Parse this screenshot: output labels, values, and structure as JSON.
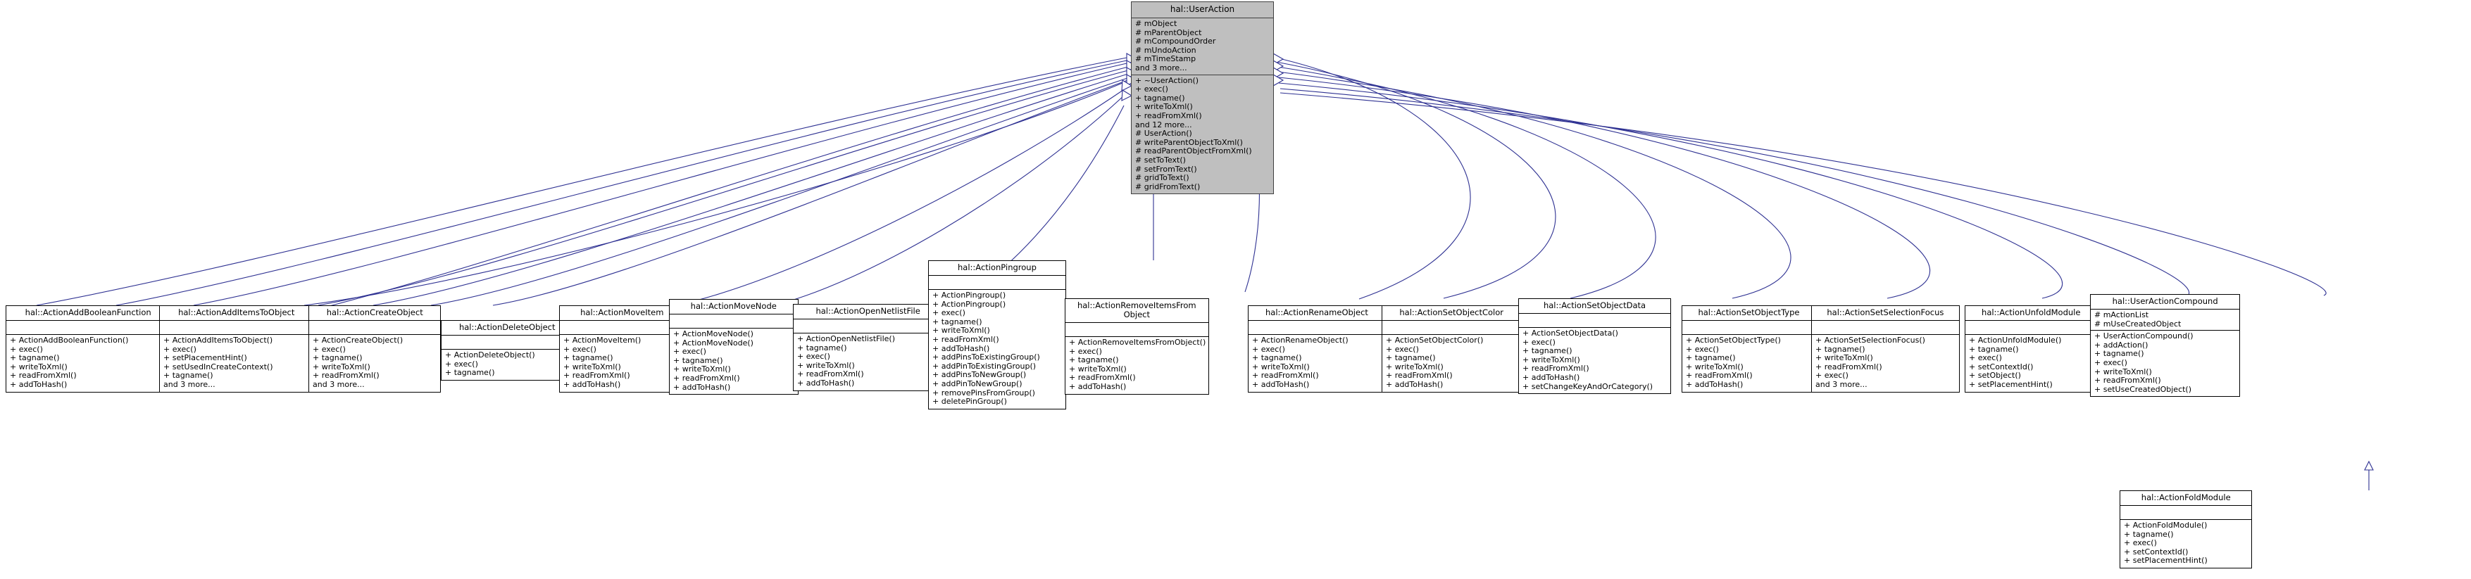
{
  "diagram": {
    "type": "uml-class-inheritance",
    "root": {
      "name": "hal::UserAction",
      "attributes": [
        "# mObject",
        "# mParentObject",
        "# mCompoundOrder",
        "# mUndoAction",
        "# mTimeStamp",
        "and 3 more..."
      ],
      "operations": [
        "+ ~UserAction()",
        "+ exec()",
        "+ tagname()",
        "+ writeToXml()",
        "+ readFromXml()",
        "and 12 more...",
        "# UserAction()",
        "# writeParentObjectToXml()",
        "# readParentObjectFromXml()",
        "# setToText()",
        "# setFromText()",
        "# gridToText()",
        "# gridFromText()"
      ]
    },
    "derived": [
      {
        "name": "hal::ActionAddBooleanFunction",
        "attributes": [],
        "operations": [
          "+ ActionAddBooleanFunction()",
          "+ exec()",
          "+ tagname()",
          "+ writeToXml()",
          "+ readFromXml()",
          "+ addToHash()"
        ]
      },
      {
        "name": "hal::ActionAddItemsToObject",
        "attributes": [],
        "operations": [
          "+ ActionAddItemsToObject()",
          "+ exec()",
          "+ setPlacementHint()",
          "+ setUsedInCreateContext()",
          "+ tagname()",
          "and 3 more..."
        ]
      },
      {
        "name": "hal::ActionCreateObject",
        "attributes": [],
        "operations": [
          "+ ActionCreateObject()",
          "+ exec()",
          "+ tagname()",
          "+ writeToXml()",
          "+ readFromXml()",
          "and 3 more..."
        ]
      },
      {
        "name": "hal::ActionDeleteObject",
        "attributes": [],
        "operations": [
          "+ ActionDeleteObject()",
          "+ exec()",
          "+ tagname()"
        ]
      },
      {
        "name": "hal::ActionMoveItem",
        "attributes": [],
        "operations": [
          "+ ActionMoveItem()",
          "+ exec()",
          "+ tagname()",
          "+ writeToXml()",
          "+ readFromXml()",
          "+ addToHash()"
        ]
      },
      {
        "name": "hal::ActionMoveNode",
        "attributes": [],
        "operations": [
          "+ ActionMoveNode()",
          "+ ActionMoveNode()",
          "+ exec()",
          "+ tagname()",
          "+ writeToXml()",
          "+ readFromXml()",
          "+ addToHash()"
        ]
      },
      {
        "name": "hal::ActionOpenNetlistFile",
        "attributes": [],
        "operations": [
          "+ ActionOpenNetlistFile()",
          "+ tagname()",
          "+ exec()",
          "+ writeToXml()",
          "+ readFromXml()",
          "+ addToHash()"
        ]
      },
      {
        "name": "hal::ActionPingroup",
        "attributes": [],
        "operations": [
          "+ ActionPingroup()",
          "+ ActionPingroup()",
          "+ exec()",
          "+ tagname()",
          "+ writeToXml()",
          "+ readFromXml()",
          "+ addToHash()",
          "+ addPinsToExistingGroup()",
          "+ addPinToExistingGroup()",
          "+ addPinsToNewGroup()",
          "+ addPinToNewGroup()",
          "+ removePinsFromGroup()",
          "+ deletePinGroup()"
        ]
      },
      {
        "name": "hal::ActionRemoveItemsFrom\nObject",
        "attributes": [],
        "operations": [
          "+ ActionRemoveItemsFromObject()",
          "+ exec()",
          "+ tagname()",
          "+ writeToXml()",
          "+ readFromXml()",
          "+ addToHash()"
        ]
      },
      {
        "name": "hal::ActionRenameObject",
        "attributes": [],
        "operations": [
          "+ ActionRenameObject()",
          "+ exec()",
          "+ tagname()",
          "+ writeToXml()",
          "+ readFromXml()",
          "+ addToHash()"
        ]
      },
      {
        "name": "hal::ActionSetObjectColor",
        "attributes": [],
        "operations": [
          "+ ActionSetObjectColor()",
          "+ exec()",
          "+ tagname()",
          "+ writeToXml()",
          "+ readFromXml()",
          "+ addToHash()"
        ]
      },
      {
        "name": "hal::ActionSetObjectData",
        "attributes": [],
        "operations": [
          "+ ActionSetObjectData()",
          "+ exec()",
          "+ tagname()",
          "+ writeToXml()",
          "+ readFromXml()",
          "+ addToHash()",
          "+ setChangeKeyAndOrCategory()"
        ]
      },
      {
        "name": "hal::ActionSetObjectType",
        "attributes": [],
        "operations": [
          "+ ActionSetObjectType()",
          "+ exec()",
          "+ tagname()",
          "+ writeToXml()",
          "+ readFromXml()",
          "+ addToHash()"
        ]
      },
      {
        "name": "hal::ActionSetSelectionFocus",
        "attributes": [],
        "operations": [
          "+ ActionSetSelectionFocus()",
          "+ tagname()",
          "+ writeToXml()",
          "+ readFromXml()",
          "+ exec()",
          "and 3 more..."
        ]
      },
      {
        "name": "hal::ActionUnfoldModule",
        "attributes": [],
        "operations": [
          "+ ActionUnfoldModule()",
          "+ tagname()",
          "+ exec()",
          "+ setContextId()",
          "+ setObject()",
          "+ setPlacementHint()"
        ]
      },
      {
        "name": "hal::UserActionCompound",
        "attributes": [
          "# mActionList",
          "# mUseCreatedObject"
        ],
        "operations": [
          "+ UserActionCompound()",
          "+ addAction()",
          "+ tagname()",
          "+ exec()",
          "+ writeToXml()",
          "+ readFromXml()",
          "+ setUseCreatedObject()"
        ]
      },
      {
        "name": "hal::ActionFoldModule",
        "attributes": [],
        "operations": [
          "+ ActionFoldModule()",
          "+ tagname()",
          "+ exec()",
          "+ setContextId()",
          "+ setPlacementHint()"
        ]
      }
    ],
    "colors": {
      "edge": "#2e3192",
      "root_fill": "#bfbfbf",
      "node_fill": "#ffffff",
      "border": "#000000"
    }
  }
}
